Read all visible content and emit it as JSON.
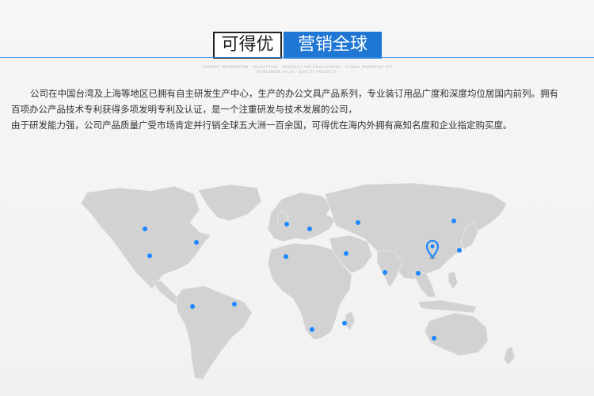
{
  "header": {
    "brand": "可得优",
    "title": "营销全球",
    "subtitle_line1": "COMPANY INFORMATION · PRODUCTION · RESEARCH AND DEVELOPMENT · GLOBAL MARKETING NETWORK",
    "subtitle_line2": "WORLDWIDE SALES · QUALITY PRODUCTS"
  },
  "description": {
    "line1": "公司在中国台湾及上海等地区已拥有自主研发生产中心，生产的办公文具产品系列，专业装订用品广度和深度均位居国内前列。拥有",
    "line2": "百项办公产品技术专利获得多项发明专利及认证，是一个注重研发与技术发展的公司，",
    "line3": "由于研发能力强，公司产品质量广受市场肯定并行销全球五大洲一百余国，可得优在海内外拥有高知名度和企业指定购买度。"
  },
  "map": {
    "accent_color": "#1e88ff",
    "land_color": "#d2d2d2",
    "marker_icon": "location-pin-icon"
  }
}
